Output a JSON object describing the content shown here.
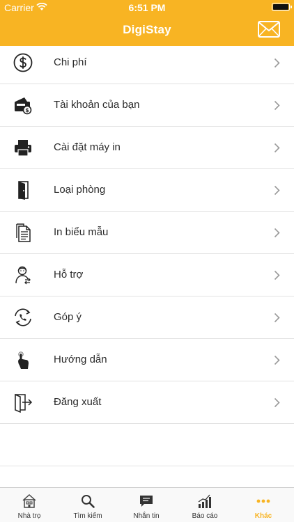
{
  "status_bar": {
    "carrier": "Carrier",
    "time": "6:51 PM"
  },
  "header": {
    "title": "DigiStay",
    "mail_icon": "envelope-icon"
  },
  "menu": [
    {
      "label": "Chi phí",
      "icon": "dollar-icon"
    },
    {
      "label": "Tài khoản của bạn",
      "icon": "wallet-icon"
    },
    {
      "label": "Cài đặt máy in",
      "icon": "printer-icon"
    },
    {
      "label": "Loại phòng",
      "icon": "door-icon"
    },
    {
      "label": "In biểu mẫu",
      "icon": "document-icon"
    },
    {
      "label": "Hỗ trợ",
      "icon": "support-icon"
    },
    {
      "label": "Góp ý",
      "icon": "phone-feedback-icon"
    },
    {
      "label": "Hướng dẫn",
      "icon": "hand-icon"
    },
    {
      "label": "Đăng xuất",
      "icon": "logout-icon"
    }
  ],
  "tabbar": {
    "active": "Khác",
    "accent": "#f8b423",
    "items": [
      {
        "label": "Nhà trọ",
        "icon": "house-icon"
      },
      {
        "label": "Tìm kiếm",
        "icon": "search-icon"
      },
      {
        "label": "Nhắn tin",
        "icon": "chat-icon"
      },
      {
        "label": "Báo cáo",
        "icon": "chart-icon"
      },
      {
        "label": "Khác",
        "icon": "more-icon"
      }
    ]
  },
  "colors": {
    "header_bg": "#f8b423",
    "divider": "#e2e2e2",
    "chevron": "#9a9a9a"
  }
}
